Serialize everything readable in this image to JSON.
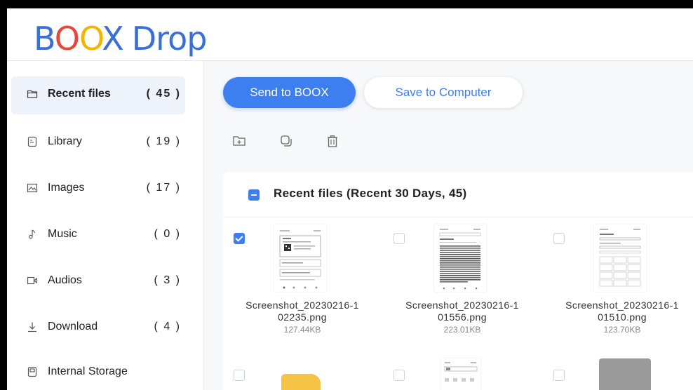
{
  "app": {
    "logo_letters": [
      "B",
      "O",
      "O",
      "X"
    ],
    "logo_suffix": "Drop"
  },
  "sidebar": {
    "items": [
      {
        "label": "Recent files",
        "count": "( 45 )",
        "icon": "folder-icon",
        "active": true
      },
      {
        "label": "Library",
        "count": "( 19 )",
        "icon": "book-icon",
        "active": false
      },
      {
        "label": "Images",
        "count": "( 17 )",
        "icon": "image-icon",
        "active": false
      },
      {
        "label": "Music",
        "count": "( 0 )",
        "icon": "music-note-icon",
        "active": false
      },
      {
        "label": "Audios",
        "count": "( 3 )",
        "icon": "audio-icon",
        "active": false
      },
      {
        "label": "Download",
        "count": "( 4 )",
        "icon": "download-icon",
        "active": false
      },
      {
        "label": "Internal Storage",
        "count": "",
        "icon": "storage-icon",
        "active": false
      }
    ]
  },
  "toolbar": {
    "send_label": "Send to BOOX",
    "save_label": "Save to Computer",
    "tools": [
      "new-folder-icon",
      "copy-icon",
      "trash-icon"
    ]
  },
  "panel": {
    "title": "Recent files (Recent 30 Days, 45)",
    "files": [
      {
        "name_line1": "Screenshot_20230216-1",
        "name_line2": "02235.png",
        "size": "127.44KB",
        "checked": true
      },
      {
        "name_line1": "Screenshot_20230216-1",
        "name_line2": "01556.png",
        "size": "223.01KB",
        "checked": false
      },
      {
        "name_line1": "Screenshot_20230216-1",
        "name_line2": "01510.png",
        "size": "123.70KB",
        "checked": false
      }
    ]
  },
  "colors": {
    "accent": "#3d7ef0",
    "logo_blue": "#3a6fd8",
    "logo_red": "#e8473c",
    "logo_yellow": "#f4b400",
    "folder_yellow": "#f5c445"
  }
}
